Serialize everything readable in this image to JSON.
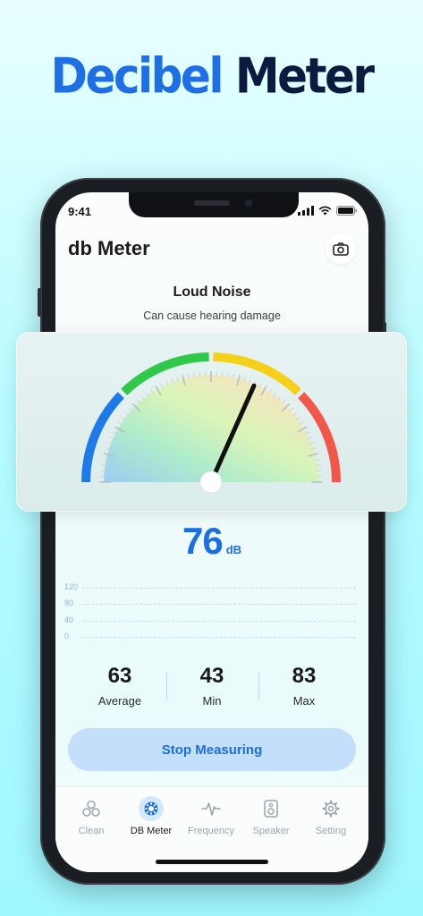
{
  "headline": {
    "word1": "Decibel",
    "word2": "Meter"
  },
  "status_bar": {
    "time": "9:41"
  },
  "app": {
    "title": "db Meter"
  },
  "level": {
    "title": "Loud Noise",
    "subtitle": "Can cause hearing damage"
  },
  "gauge": {
    "value": 76,
    "min": 0,
    "max": 120,
    "zone_colors": [
      "#1e7ae8",
      "#2fc84a",
      "#f5d01a",
      "#f2574a"
    ]
  },
  "reading": {
    "value": "76",
    "unit": "dB"
  },
  "history_axis": {
    "labels": [
      "120",
      "80",
      "40",
      "0"
    ]
  },
  "stats": [
    {
      "value": "63",
      "label": "Average"
    },
    {
      "value": "43",
      "label": "Min"
    },
    {
      "value": "83",
      "label": "Max"
    }
  ],
  "action": {
    "label": "Stop Measuring"
  },
  "tabs": [
    {
      "label": "Clean",
      "icon": "bubbles-icon"
    },
    {
      "label": "DB Meter",
      "icon": "gauge-icon"
    },
    {
      "label": "Frequency",
      "icon": "pulse-icon"
    },
    {
      "label": "Speaker",
      "icon": "speaker-icon"
    },
    {
      "label": "Setting",
      "icon": "gear-icon"
    }
  ],
  "colors": {
    "accent": "#1b6fe0",
    "headline_blue": "#1e6fe6",
    "headline_dark": "#0b1b3f"
  }
}
